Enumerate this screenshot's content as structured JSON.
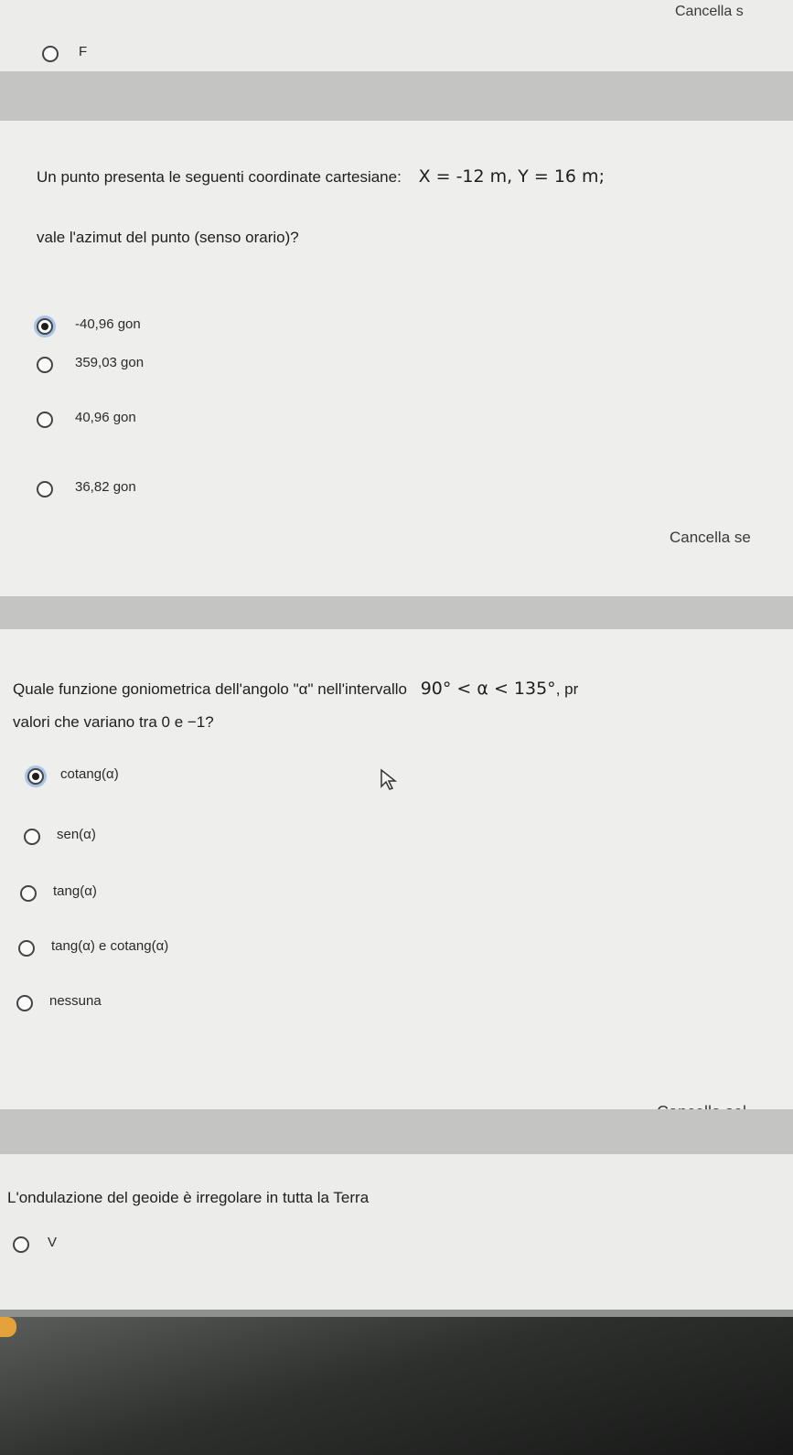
{
  "previous_question": {
    "clear_label": "Cancella s",
    "option_label": "F"
  },
  "question1": {
    "text_line1": "Un punto presenta le seguenti coordinate cartesiane:",
    "math": "X = -12 m, Y = 16 m;",
    "text_line2": "vale l'azimut del punto (senso orario)?",
    "options": [
      {
        "label": "-40,96 gon",
        "selected": true
      },
      {
        "label": "359,03 gon",
        "selected": false
      },
      {
        "label": "40,96 gon",
        "selected": false
      },
      {
        "label": "36,82 gon",
        "selected": false
      }
    ],
    "clear_label": "Cancella se"
  },
  "question2": {
    "text_line1": "Quale funzione goniometrica dell'angolo \"α\" nell'intervallo",
    "math": "90° < α < 135°",
    "text_line1_tail": ", pr",
    "text_line2": "valori che variano tra 0 e −1?",
    "options": [
      {
        "label": "cotang(α)",
        "selected": true
      },
      {
        "label": "sen(α)",
        "selected": false
      },
      {
        "label": "tang(α)",
        "selected": false
      },
      {
        "label": "tang(α) e cotang(α)",
        "selected": false
      },
      {
        "label": "nessuna",
        "selected": false
      }
    ],
    "clear_label": "Cancella sel"
  },
  "question3": {
    "text": "L'ondulazione del geoide è irregolare in tutta la Terra",
    "option_label": "V"
  },
  "colors": {
    "card_background": "#eeeeec",
    "page_background": "#d3d4d2",
    "selected_ring": "#aac4e6"
  }
}
